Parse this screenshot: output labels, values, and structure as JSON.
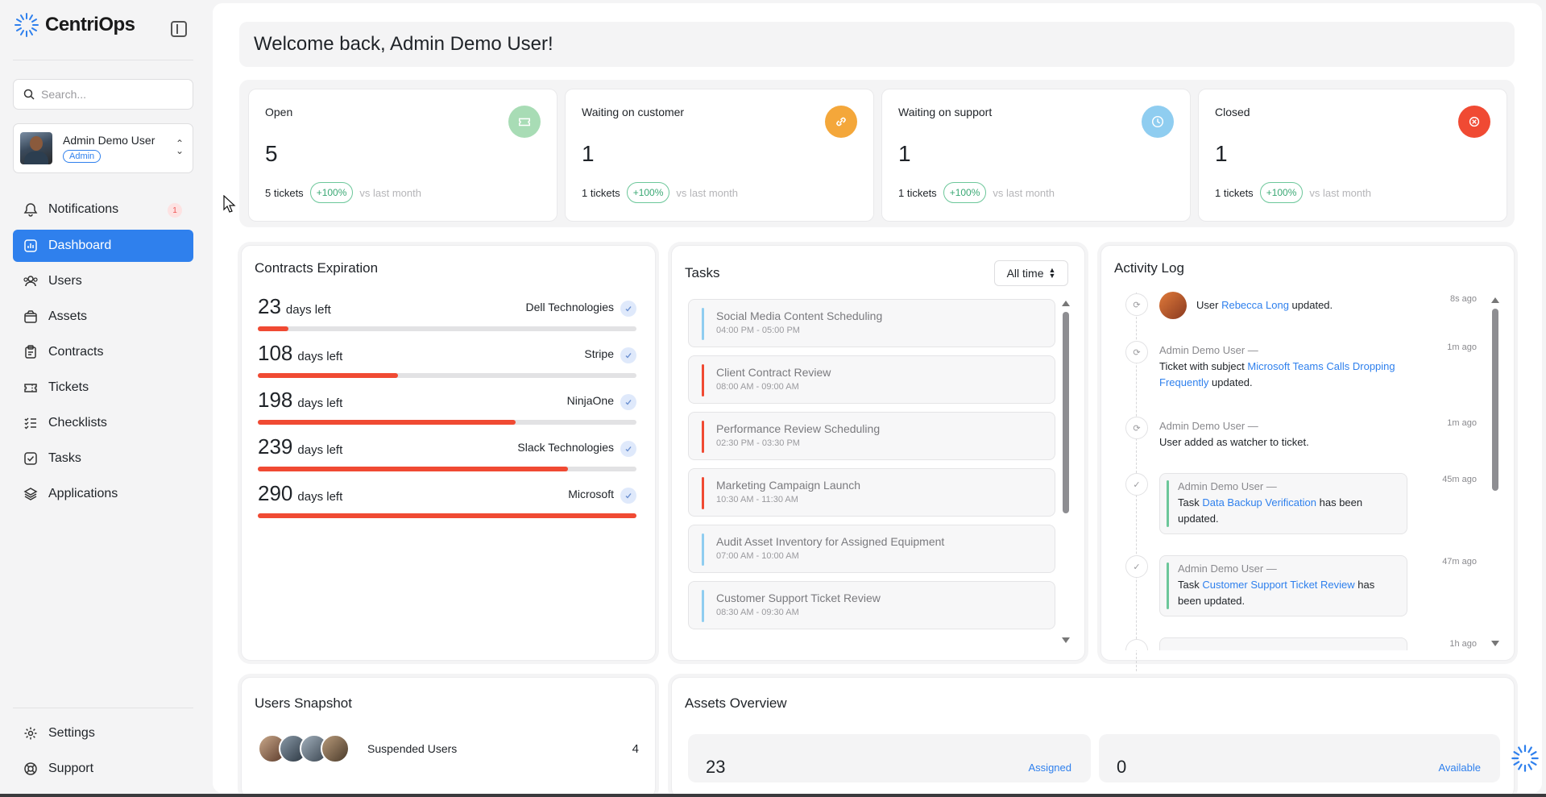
{
  "app": {
    "name": "CentriOps"
  },
  "search": {
    "placeholder": "Search..."
  },
  "user": {
    "name": "Admin Demo User",
    "role": "Admin"
  },
  "nav": [
    {
      "label": "Notifications",
      "badge": "1"
    },
    {
      "label": "Dashboard"
    },
    {
      "label": "Users"
    },
    {
      "label": "Assets"
    },
    {
      "label": "Contracts"
    },
    {
      "label": "Tickets"
    },
    {
      "label": "Checklists"
    },
    {
      "label": "Tasks"
    },
    {
      "label": "Applications"
    }
  ],
  "nav_bottom": [
    {
      "label": "Settings"
    },
    {
      "label": "Support"
    }
  ],
  "welcome": "Welcome back, Admin Demo User!",
  "stats": [
    {
      "label": "Open",
      "value": "5",
      "tickets": "5 tickets",
      "change": "+100%",
      "vs": "vs last month",
      "color": "#a8dcb5",
      "icon": "ticket-icon"
    },
    {
      "label": "Waiting on customer",
      "value": "1",
      "tickets": "1 tickets",
      "change": "+100%",
      "vs": "vs last month",
      "color": "#f4a73a",
      "icon": "link-icon"
    },
    {
      "label": "Waiting on support",
      "value": "1",
      "tickets": "1 tickets",
      "change": "+100%",
      "vs": "vs last month",
      "color": "#8fcdf0",
      "icon": "clock-icon"
    },
    {
      "label": "Closed",
      "value": "1",
      "tickets": "1 tickets",
      "change": "+100%",
      "vs": "vs last month",
      "color": "#f04a33",
      "icon": "x-circle-icon"
    }
  ],
  "contracts": {
    "title": "Contracts Expiration",
    "days_label": "days left",
    "items": [
      {
        "days": "23",
        "vendor": "Dell Technologies",
        "progress": 0.08
      },
      {
        "days": "108",
        "vendor": "Stripe",
        "progress": 0.37
      },
      {
        "days": "198",
        "vendor": "NinjaOne",
        "progress": 0.68
      },
      {
        "days": "239",
        "vendor": "Slack Technologies",
        "progress": 0.82
      },
      {
        "days": "290",
        "vendor": "Microsoft",
        "progress": 1.0
      }
    ]
  },
  "tasks": {
    "title": "Tasks",
    "filter": "All time",
    "items": [
      {
        "title": "Social Media Content Scheduling",
        "time": "04:00 PM - 05:00 PM",
        "color": "#8fcdf0"
      },
      {
        "title": "Client Contract Review",
        "time": "08:00 AM - 09:00 AM",
        "color": "#f04a33"
      },
      {
        "title": "Performance Review Scheduling",
        "time": "02:30 PM - 03:30 PM",
        "color": "#f04a33"
      },
      {
        "title": "Marketing Campaign Launch",
        "time": "10:30 AM - 11:30 AM",
        "color": "#f04a33"
      },
      {
        "title": "Audit Asset Inventory for Assigned Equipment",
        "time": "07:00 AM - 10:00 AM",
        "color": "#8fcdf0"
      },
      {
        "title": "Customer Support Ticket Review",
        "time": "08:30 AM - 09:30 AM",
        "color": "#8fcdf0"
      }
    ]
  },
  "activity": {
    "title": "Activity Log",
    "items": [
      {
        "time": "8s ago",
        "prefix": "User",
        "link": "Rebecca Long",
        "suffix": "updated."
      },
      {
        "time": "1m ago",
        "head": "Admin Demo User —",
        "prefix": "Ticket with subject",
        "link": "Microsoft Teams Calls Dropping Frequently",
        "suffix": "updated."
      },
      {
        "time": "1m ago",
        "head": "Admin Demo User —",
        "text": "User added as watcher to ticket."
      },
      {
        "time": "45m ago",
        "head": "Admin Demo User —",
        "prefix": "Task",
        "link": "Data Backup Verification",
        "suffix": "has been updated."
      },
      {
        "time": "47m ago",
        "head": "Admin Demo User —",
        "prefix": "Task",
        "link": "Customer Support Ticket Review",
        "suffix": "has been updated."
      },
      {
        "time": "1h ago"
      }
    ]
  },
  "users_snapshot": {
    "title": "Users Snapshot",
    "label": "Suspended Users",
    "count": "4"
  },
  "assets": {
    "title": "Assets Overview",
    "cards": [
      {
        "value": "23",
        "label": "Assigned"
      },
      {
        "value": "0",
        "label": "Available"
      }
    ]
  }
}
